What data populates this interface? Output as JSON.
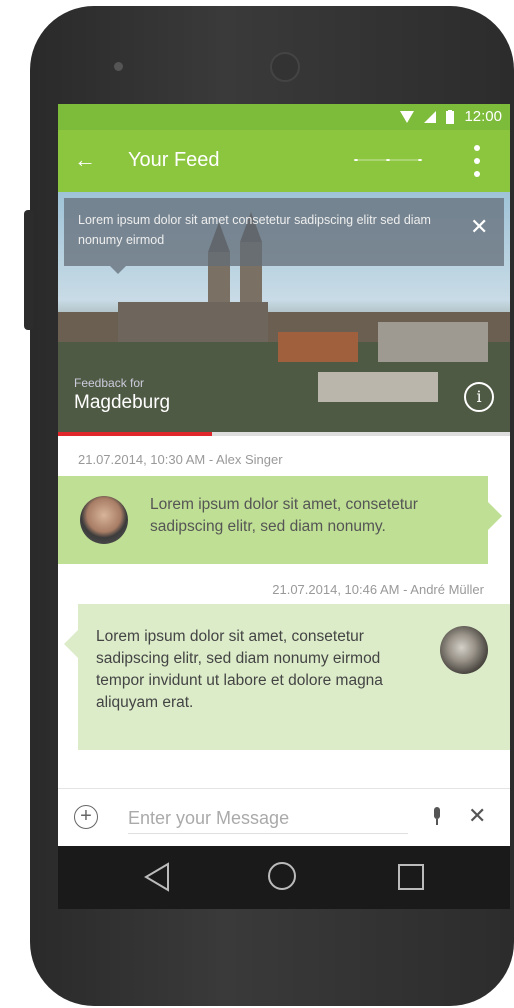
{
  "status_bar": {
    "time": "12:00",
    "wifi_icon": "wifi-icon",
    "signal_icon": "signal-icon",
    "battery_icon": "battery-icon"
  },
  "app_bar": {
    "title": "Your Feed",
    "back_icon": "back-arrow-icon",
    "more_icon": "more-vert-icon",
    "page_indicator_icon": "page-indicator-icon"
  },
  "hero": {
    "tooltip_text": "Lorem ipsum dolor sit amet consetetur sadipscing elitr sed diam nonumy eirmod",
    "subtitle": "Feedback for",
    "title": "Magdeburg",
    "info_symbol": "i",
    "progress": 0.34,
    "progress_color": "#e0282c"
  },
  "messages": [
    {
      "meta": "21.07.2014, 10:30 AM - Alex Singer",
      "text": "Lorem ipsum dolor sit amet, consetetur sadipscing elitr, sed diam nonumy.",
      "side": "left",
      "bubble_color": "#bfe094"
    },
    {
      "meta": "21.07.2014, 10:46 AM - André Müller",
      "text": "Lorem ipsum dolor sit amet, consetetur sadipscing elitr, sed diam nonumy eirmod tempor invidunt ut labore et dolore magna aliquyam erat.",
      "side": "right",
      "bubble_color": "#dcecc9"
    }
  ],
  "input": {
    "placeholder": "Enter your Message",
    "value": "",
    "add_icon": "plus-circle-icon",
    "mic_icon": "mic-icon",
    "clear_icon": "close-icon"
  },
  "nav": {
    "back_icon": "nav-back-icon",
    "home_icon": "nav-home-icon",
    "recent_icon": "nav-recent-icon"
  },
  "colors": {
    "accent": "#8cc63f",
    "status_bar": "#7dbb3a"
  }
}
